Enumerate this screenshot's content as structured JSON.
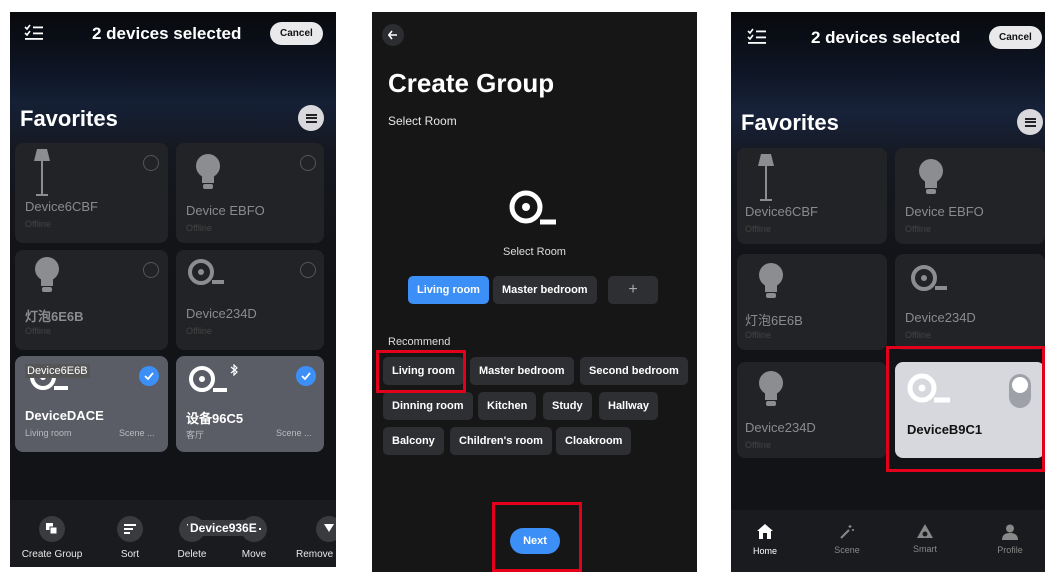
{
  "screen1": {
    "header_title": "2 devices selected",
    "cancel_label": "Cancel",
    "favorites_label": "Favorites",
    "cards": [
      {
        "name": "Device6CBF",
        "sub": "Offline"
      },
      {
        "name": "Device EBFO",
        "sub": "Offline"
      },
      {
        "name": "灯泡6E6B",
        "sub": "Offline"
      },
      {
        "name": "Device234D",
        "sub": "Offline"
      },
      {
        "name": "DeviceDACE",
        "sub": "Living room",
        "scene": "Scene ...",
        "overlay": "Device6E6B"
      },
      {
        "name": "设备96C5",
        "sub": "客厅",
        "scene": "Scene ..."
      }
    ],
    "toolbar": {
      "create_group": "Create Group",
      "sort": "Sort",
      "delete": "Delete",
      "move": "Move",
      "remove": "Remove"
    },
    "drag_label": "Device936E"
  },
  "screen2": {
    "title": "Create Group",
    "subtitle": "Select Room",
    "center_label": "Select Room",
    "rooms": [
      "Living room",
      "Master bedroom"
    ],
    "add_label": "+",
    "recommend_label": "Recommend",
    "recommend": [
      "Living room",
      "Master bedroom",
      "Second bedroom",
      "Dinning room",
      "Kitchen",
      "Study",
      "Hallway",
      "Balcony",
      "Children's room",
      "Cloakroom"
    ],
    "next_label": "Next"
  },
  "screen3": {
    "header_title": "2 devices selected",
    "cancel_label": "Cancel",
    "favorites_label": "Favorites",
    "cards": [
      {
        "name": "Device6CBF",
        "sub": "Offline"
      },
      {
        "name": "Device EBFO",
        "sub": "Offline"
      },
      {
        "name": "灯泡6E6B",
        "sub": "Offline"
      },
      {
        "name": "Device234D",
        "sub": "Offline"
      },
      {
        "name": "Device234D",
        "sub": "Offline"
      },
      {
        "name": "DeviceB9C1",
        "sub": ""
      }
    ],
    "nav": {
      "home": "Home",
      "scene": "Scene",
      "smart": "Smart",
      "profile": "Profile"
    }
  },
  "colors": {
    "accent": "#3b8ff6",
    "highlight": "#e3001b"
  }
}
